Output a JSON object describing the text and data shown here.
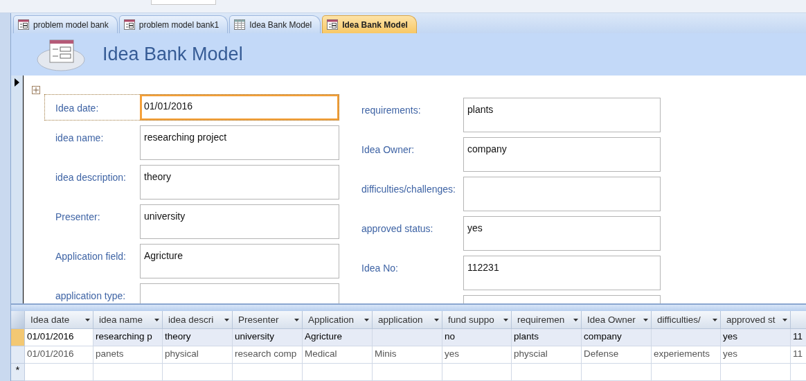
{
  "tabs": [
    {
      "label": "problem model bank",
      "kind": "form",
      "selected": false
    },
    {
      "label": "problem model bank1",
      "kind": "form",
      "selected": false
    },
    {
      "label": "Idea Bank Model",
      "kind": "table",
      "selected": false
    },
    {
      "label": "Idea Bank Model",
      "kind": "form",
      "selected": true
    }
  ],
  "form": {
    "title": "Idea Bank Model",
    "left_fields": [
      {
        "label": "Idea date:",
        "value": "01/01/2016",
        "selected": true
      },
      {
        "label": "idea name:",
        "value": "researching project",
        "selected": false
      },
      {
        "label": "idea description:",
        "value": "theory",
        "selected": false
      },
      {
        "label": "Presenter:",
        "value": "university",
        "selected": false
      },
      {
        "label": "Application field:",
        "value": "Agricture",
        "selected": false
      },
      {
        "label": "application type:",
        "selected": false
      }
    ],
    "right_fields": [
      {
        "label": "requirements:",
        "value": "plants",
        "selected": false
      },
      {
        "label": "Idea Owner:",
        "value": "company",
        "selected": false
      },
      {
        "label": "difficulties/challenges:",
        "selected": false
      },
      {
        "label": "approved status:",
        "value": "yes",
        "selected": false
      },
      {
        "label": "Idea No:",
        "value": "112231",
        "selected": false
      },
      {
        "selected": false
      }
    ]
  },
  "table": {
    "columns": [
      "Idea date",
      "idea name",
      "idea descri",
      "Presenter",
      "Application",
      "application",
      "fund suppo",
      "requiremen",
      "Idea Owner",
      "difficulties/",
      "approved st"
    ],
    "rows": [
      {
        "selected": true,
        "cells": [
          "01/01/2016",
          "researching p",
          "theory",
          "university",
          "Agricture",
          null,
          "no",
          "plants",
          "company",
          null,
          "yes",
          "11"
        ]
      },
      {
        "selected": false,
        "cells": [
          "01/01/2016",
          "panets",
          "physical",
          "research comp",
          "Medical",
          "Minis",
          "yes",
          "physcial",
          "Defense",
          "experiements",
          "yes",
          "11"
        ]
      }
    ],
    "new_row_marker": "*"
  }
}
